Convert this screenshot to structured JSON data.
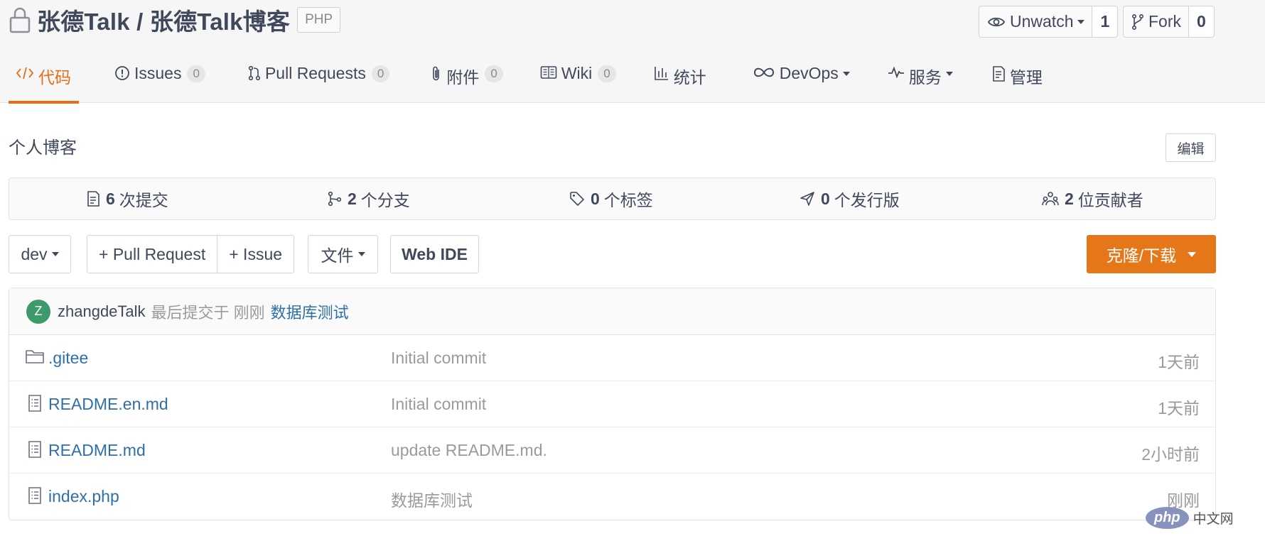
{
  "repo": {
    "title": "张德Talk / 张德Talk博客",
    "language": "PHP"
  },
  "social": {
    "watch": {
      "label": "Unwatch",
      "count": "1"
    },
    "fork": {
      "label": "Fork",
      "count": "0"
    }
  },
  "tabs": [
    {
      "label": "代码",
      "icon": "code-icon",
      "active": true
    },
    {
      "label": "Issues",
      "icon": "issue-icon",
      "badge": "0"
    },
    {
      "label": "Pull Requests",
      "icon": "pull-request-icon",
      "badge": "0"
    },
    {
      "label": "附件",
      "icon": "attachment-icon",
      "badge": "0"
    },
    {
      "label": "Wiki",
      "icon": "wiki-icon",
      "badge": "0"
    },
    {
      "label": "统计",
      "icon": "stats-icon"
    },
    {
      "label": "DevOps",
      "icon": "infinity-icon",
      "dropdown": true
    },
    {
      "label": "服务",
      "icon": "pulse-icon",
      "dropdown": true
    },
    {
      "label": "管理",
      "icon": "manage-icon"
    }
  ],
  "description": {
    "text": "个人博客",
    "edit_label": "编辑"
  },
  "stats": [
    {
      "count": "6",
      "label": "次提交",
      "icon": "commit-icon"
    },
    {
      "count": "2",
      "label": "个分支",
      "icon": "branch-icon"
    },
    {
      "count": "0",
      "label": "个标签",
      "icon": "tag-icon"
    },
    {
      "count": "0",
      "label": "个发行版",
      "icon": "release-icon"
    },
    {
      "count": "2",
      "label": "位贡献者",
      "icon": "contributors-icon"
    }
  ],
  "toolbar": {
    "branch": "dev",
    "pull_request": "+ Pull Request",
    "issue": "+ Issue",
    "file": "文件",
    "web_ide": "Web IDE",
    "clone": "克隆/下载"
  },
  "last_commit": {
    "avatar_letter": "Z",
    "author": "zhangdeTalk",
    "meta": "最后提交于 刚刚",
    "message": "数据库测试"
  },
  "files": [
    {
      "name": ".gitee",
      "type": "folder",
      "message": "Initial commit",
      "time": "1天前"
    },
    {
      "name": "README.en.md",
      "type": "file",
      "message": "Initial commit",
      "time": "1天前"
    },
    {
      "name": "README.md",
      "type": "file",
      "message": "update README.md.",
      "time": "2小时前"
    },
    {
      "name": "index.php",
      "type": "file",
      "message": "数据库测试",
      "time": "刚刚"
    }
  ],
  "watermark": {
    "logo": "php",
    "text": "中文网"
  },
  "colors": {
    "accent": "#e46f1b",
    "link": "#2e6fa9",
    "text": "#40485b",
    "muted": "#9a9a9a",
    "clone_bg": "#e57718",
    "avatar_bg": "#3e9a6b"
  }
}
